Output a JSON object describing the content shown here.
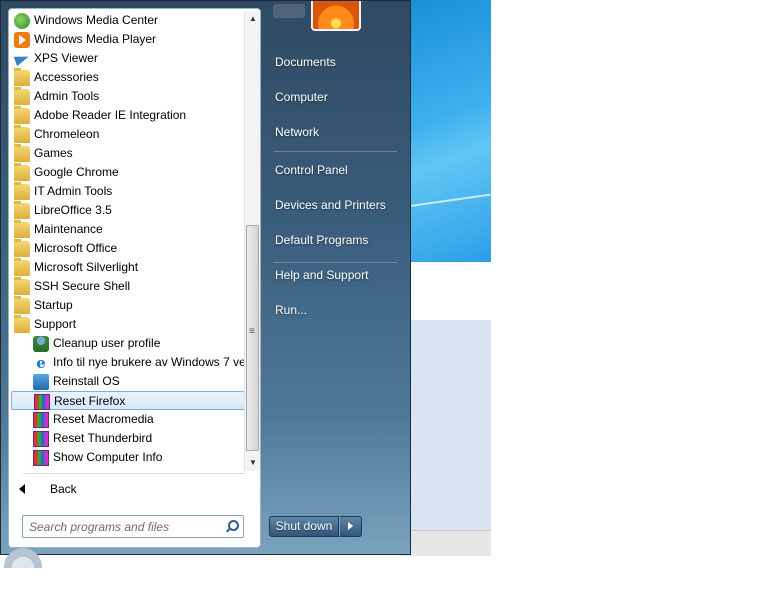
{
  "programs": [
    {
      "label": "Windows Media Center",
      "icon": "windows-media-center-icon",
      "type": "wmc",
      "level": 0
    },
    {
      "label": "Windows Media Player",
      "icon": "windows-media-player-icon",
      "type": "wmp",
      "level": 0
    },
    {
      "label": "XPS Viewer",
      "icon": "xps-viewer-icon",
      "type": "xps",
      "level": 0
    },
    {
      "label": "Accessories",
      "icon": "folder-icon",
      "type": "folder",
      "level": 0
    },
    {
      "label": "Admin Tools",
      "icon": "folder-icon",
      "type": "folder",
      "level": 0
    },
    {
      "label": "Adobe Reader IE Integration",
      "icon": "folder-icon",
      "type": "folder",
      "level": 0
    },
    {
      "label": "Chromeleon",
      "icon": "folder-icon",
      "type": "folder",
      "level": 0
    },
    {
      "label": "Games",
      "icon": "folder-icon",
      "type": "folder",
      "level": 0
    },
    {
      "label": "Google Chrome",
      "icon": "folder-icon",
      "type": "folder",
      "level": 0
    },
    {
      "label": "IT Admin Tools",
      "icon": "folder-icon",
      "type": "folder",
      "level": 0
    },
    {
      "label": "LibreOffice 3.5",
      "icon": "folder-icon",
      "type": "folder",
      "level": 0
    },
    {
      "label": "Maintenance",
      "icon": "folder-icon",
      "type": "folder",
      "level": 0
    },
    {
      "label": "Microsoft Office",
      "icon": "folder-icon",
      "type": "folder",
      "level": 0
    },
    {
      "label": "Microsoft Silverlight",
      "icon": "folder-icon",
      "type": "folder",
      "level": 0
    },
    {
      "label": "SSH Secure Shell",
      "icon": "folder-icon",
      "type": "folder",
      "level": 0
    },
    {
      "label": "Startup",
      "icon": "folder-icon",
      "type": "folder",
      "level": 0
    },
    {
      "label": "Support",
      "icon": "folder-icon",
      "type": "folder",
      "level": 0
    },
    {
      "label": "Cleanup user profile",
      "icon": "user-profile-icon",
      "type": "user",
      "level": 1
    },
    {
      "label": "Info til nye brukere av Windows 7 ve",
      "icon": "internet-explorer-icon",
      "type": "ie",
      "level": 1
    },
    {
      "label": "Reinstall OS",
      "icon": "reinstall-os-icon",
      "type": "os",
      "level": 1
    },
    {
      "label": "Reset Firefox",
      "icon": "script-icon",
      "type": "bar",
      "level": 1,
      "highlight": true
    },
    {
      "label": "Reset Macromedia",
      "icon": "script-icon",
      "type": "bar",
      "level": 1
    },
    {
      "label": "Reset Thunderbird",
      "icon": "script-icon",
      "type": "bar",
      "level": 1
    },
    {
      "label": "Show Computer Info",
      "icon": "script-icon",
      "type": "bar",
      "level": 1
    }
  ],
  "back": {
    "label": "Back"
  },
  "search": {
    "placeholder": "Search programs and files"
  },
  "right_pane": {
    "items": [
      {
        "label": "Documents",
        "name": "documents"
      },
      {
        "label": "Computer",
        "name": "computer"
      },
      {
        "label": "Network",
        "name": "network"
      },
      {
        "label": "Control Panel",
        "name": "control-panel"
      },
      {
        "label": "Devices and Printers",
        "name": "devices-and-printers"
      },
      {
        "label": "Default Programs",
        "name": "default-programs"
      },
      {
        "label": "Help and Support",
        "name": "help-and-support"
      },
      {
        "label": "Run...",
        "name": "run"
      }
    ]
  },
  "shutdown": {
    "label": "Shut down"
  },
  "colors": {
    "highlight": "#d7e8fb",
    "menu_dark": "#2f4a63",
    "right_text": "#ffffff"
  }
}
